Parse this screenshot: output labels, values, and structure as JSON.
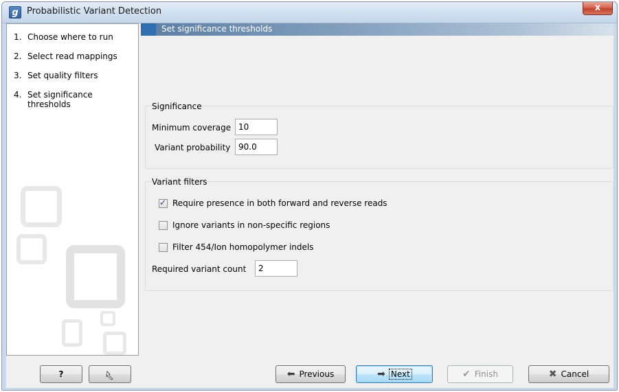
{
  "window": {
    "title": "Probabilistic Variant Detection",
    "app_icon": "g",
    "close_label": "x"
  },
  "steps": [
    {
      "num": "1.",
      "label": "Choose where to run"
    },
    {
      "num": "2.",
      "label": "Select read mappings"
    },
    {
      "num": "3.",
      "label": "Set quality filters"
    },
    {
      "num": "4.",
      "label": "Set significance thresholds"
    }
  ],
  "panel": {
    "header": "Set significance thresholds",
    "significance": {
      "title": "Significance",
      "min_coverage_label": "Minimum coverage",
      "min_coverage_value": "10",
      "variant_probability_label": "Variant probability",
      "variant_probability_value": "90.0"
    },
    "variant_filters": {
      "title": "Variant filters",
      "checkboxes": [
        {
          "label": "Require presence in both forward and reverse reads",
          "checked": true
        },
        {
          "label": "Ignore variants in non-specific regions",
          "checked": false
        },
        {
          "label": "Filter 454/Ion homopolymer indels",
          "checked": false
        }
      ],
      "required_count_label": "Required variant count",
      "required_count_value": "2"
    }
  },
  "footer": {
    "help_label": "?",
    "help_icon": "question-mark-icon",
    "restore_icon": "reset-arrow-icon",
    "previous_label": "Previous",
    "next_label": "Next",
    "finish_label": "Finish",
    "cancel_label": "Cancel"
  },
  "colors": {
    "header_accent": "#2f6fb0",
    "close_button": "#c0412a",
    "default_button_border": "#3c7fb1"
  }
}
